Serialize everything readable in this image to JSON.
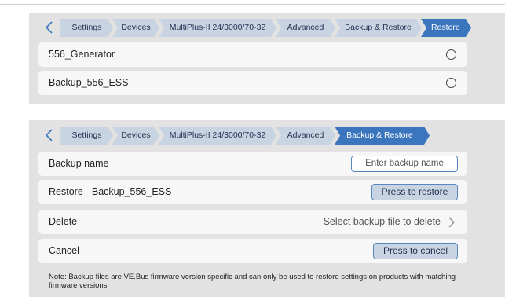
{
  "panel1": {
    "breadcrumbs": [
      "Settings",
      "Devices",
      "MultiPlus-II 24/3000/70-32",
      "Advanced",
      "Backup & Restore",
      "Restore"
    ],
    "active_crumb": "Restore",
    "items": [
      {
        "label": "556_Generator",
        "selected": false
      },
      {
        "label": "Backup_556_ESS",
        "selected": false
      }
    ]
  },
  "panel2": {
    "breadcrumbs": [
      "Settings",
      "Devices",
      "MultiPlus-II 24/3000/70-32",
      "Advanced",
      "Backup & Restore"
    ],
    "active_crumb": "Backup & Restore",
    "backup_name": {
      "label": "Backup name",
      "placeholder": "Enter backup name"
    },
    "restore": {
      "label": "Restore - Backup_556_ESS",
      "button": "Press to restore"
    },
    "delete": {
      "label": "Delete",
      "value": "Select backup file to delete"
    },
    "cancel": {
      "label": "Cancel",
      "button": "Press to cancel"
    },
    "note": "Note: Backup files are VE.Bus firmware version specific and can only be used to restore settings on products with matching firmware versions"
  },
  "colors": {
    "panel_bg": "#e2e2e2",
    "crumb_bg": "#c9d4e2",
    "crumb_active": "#3a75bd",
    "accent": "#5a86bf"
  }
}
